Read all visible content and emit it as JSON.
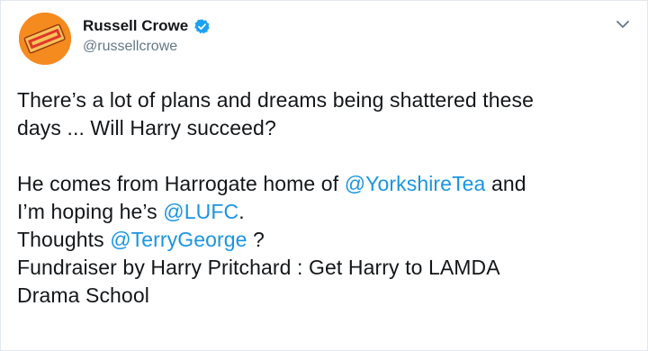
{
  "author": {
    "display_name": "Russell Crowe",
    "handle": "@russellcrowe",
    "verified": true,
    "avatar_icon": "yorkshire-tea-box-avatar"
  },
  "menu": {
    "icon": "chevron-down-icon"
  },
  "tweet": {
    "line1": "There’s a lot of plans and dreams being shattered these",
    "line2": "days ... Will Harry succeed?",
    "line3_prefix": "He comes from Harrogate home of ",
    "line3_mention": "@YorkshireTea",
    "line3_suffix": " and",
    "line4_prefix": "I’m hoping he’s ",
    "line4_mention": "@LUFC",
    "line4_suffix": ".",
    "line5_prefix": "Thoughts ",
    "line5_mention": "@TerryGeorge",
    "line5_suffix": " ?",
    "line6": "Fundraiser by Harry Pritchard : Get Harry to LAMDA",
    "line7": "Drama School"
  },
  "colors": {
    "link": "#1b95e0",
    "text": "#14171a",
    "muted": "#657786",
    "verified": "#1da1f2",
    "avatar_bg": "#f58a1f"
  }
}
